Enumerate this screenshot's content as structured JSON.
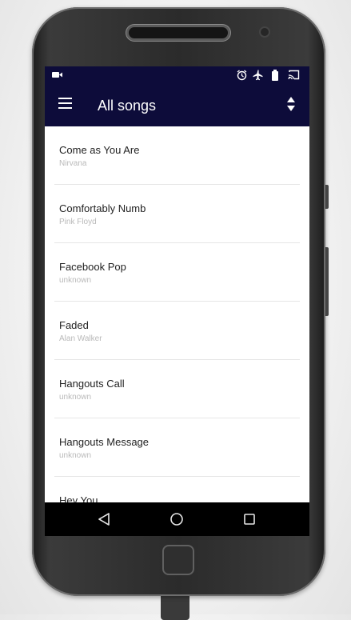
{
  "toolbar": {
    "title": "All songs"
  },
  "icons": {
    "status_left": "video-camera-icon",
    "status_right": [
      "alarm-icon",
      "airplane-icon",
      "battery-icon",
      "cast-icon"
    ],
    "toolbar_left": "menu-icon",
    "toolbar_right": "sort-icon",
    "nav": [
      "back-icon",
      "home-icon",
      "recents-icon"
    ]
  },
  "songs": [
    {
      "title": "Come as You Are",
      "artist": "Nirvana"
    },
    {
      "title": "Comfortably Numb",
      "artist": "Pink Floyd"
    },
    {
      "title": "Facebook Pop",
      "artist": "unknown"
    },
    {
      "title": "Faded",
      "artist": "Alan Walker"
    },
    {
      "title": "Hangouts Call",
      "artist": "unknown"
    },
    {
      "title": "Hangouts Message",
      "artist": "unknown"
    },
    {
      "title": "Hey You",
      "artist": ""
    }
  ],
  "colors": {
    "app_bar": "#0d0c3a",
    "screen_bg": "#ffffff",
    "nav_bar": "#000000"
  }
}
